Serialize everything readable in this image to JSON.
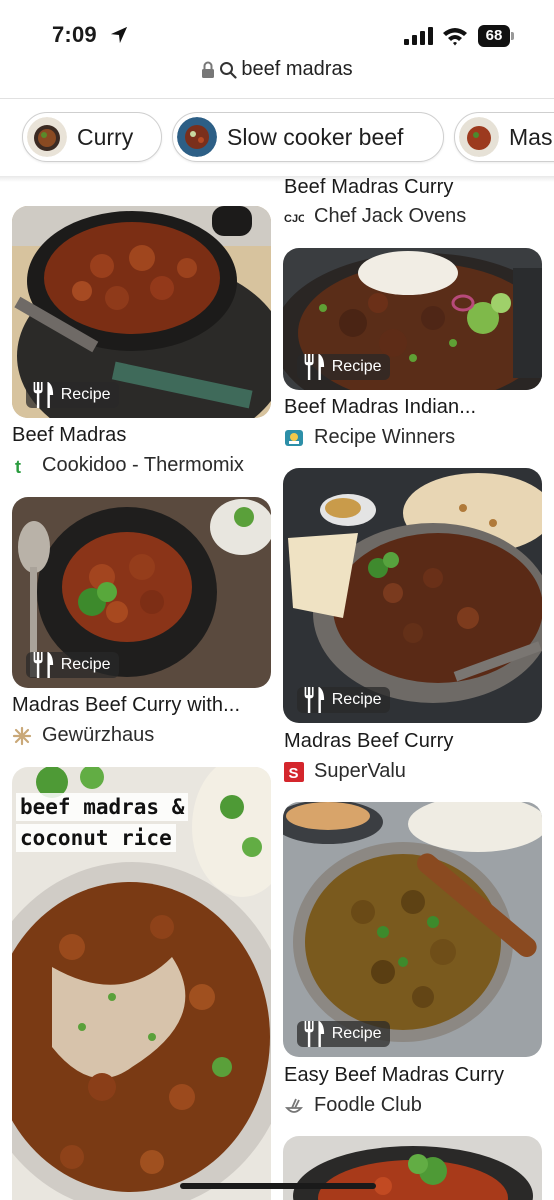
{
  "status_bar": {
    "time": "7:09",
    "battery": "68"
  },
  "url_bar": {
    "text": "beef madras"
  },
  "chips": [
    {
      "label": "Curry"
    },
    {
      "label": "Slow cooker beef"
    },
    {
      "label": "Mas"
    }
  ],
  "pins": {
    "top_right": {
      "title": "Beef Madras Curry",
      "source": "Chef Jack Ovens"
    },
    "left_1": {
      "title": "Beef Madras",
      "source": "Cookidoo - Thermomix",
      "badge": "Recipe"
    },
    "right_1": {
      "title": "Beef Madras Indian...",
      "source": "Recipe Winners",
      "badge": "Recipe"
    },
    "left_2": {
      "title": "Madras Beef Curry with...",
      "source": "Gewürzhaus",
      "badge": "Recipe"
    },
    "right_2": {
      "title": "Madras Beef Curry",
      "source": "SuperValu",
      "badge": "Recipe"
    },
    "left_3": {
      "overlay_line1": "beef madras &",
      "overlay_line2": "coconut rice"
    },
    "right_3": {
      "title": "Easy Beef Madras Curry",
      "source": "Foodle Club",
      "badge": "Recipe"
    }
  },
  "colors": {
    "accent_red": "#d4262c",
    "thermomix_green": "#2b9c3f"
  }
}
